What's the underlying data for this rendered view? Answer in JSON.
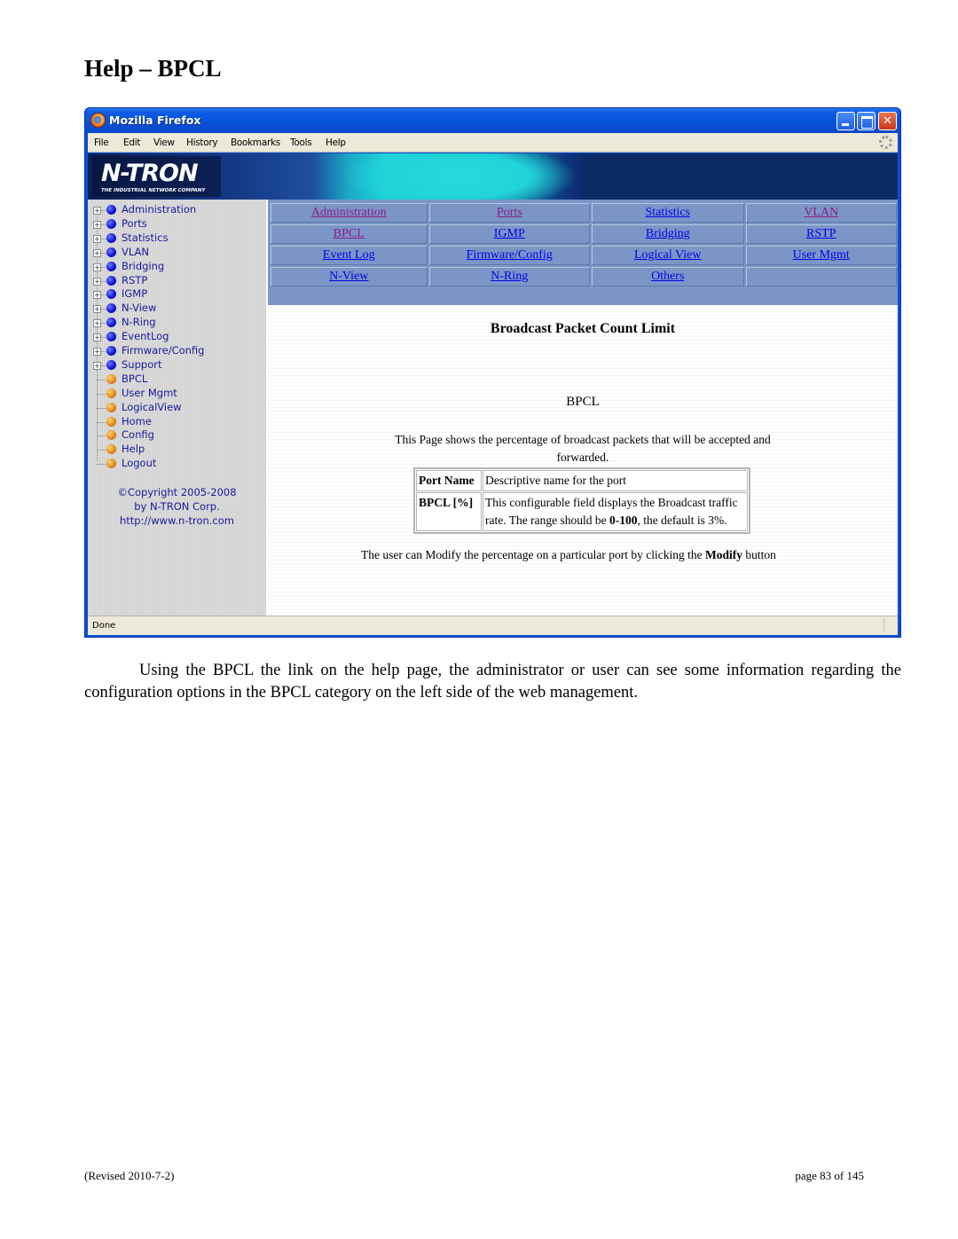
{
  "document": {
    "title": "Help – BPCL",
    "paragraph": "Using the BPCL the link on the help page, the administrator or user can see some information regarding the configuration options in the BPCL category on the left side of the web management.",
    "footer_left": "(Revised 2010-7-2)",
    "footer_right": "page 83 of 145"
  },
  "browser": {
    "app_title": "Mozilla Firefox",
    "menu": [
      "File",
      "Edit",
      "View",
      "History",
      "Bookmarks",
      "Tools",
      "Help"
    ],
    "status": "Done",
    "colors": {
      "titlebar": "#0550d8",
      "chrome": "#ece9d8"
    }
  },
  "banner": {
    "logo": "N-TRON",
    "tagline": "THE INDUSTRIAL NETWORK COMPANY"
  },
  "sidebar": {
    "expandable_items": [
      {
        "label": "Administration",
        "icon": "blue-bullet-icon"
      },
      {
        "label": "Ports",
        "icon": "blue-bullet-icon"
      },
      {
        "label": "Statistics",
        "icon": "blue-bullet-icon"
      },
      {
        "label": "VLAN",
        "icon": "blue-bullet-icon"
      },
      {
        "label": "Bridging",
        "icon": "blue-bullet-icon"
      },
      {
        "label": "RSTP",
        "icon": "blue-bullet-icon"
      },
      {
        "label": "IGMP",
        "icon": "blue-bullet-icon"
      },
      {
        "label": "N-View",
        "icon": "blue-bullet-icon"
      },
      {
        "label": "N-Ring",
        "icon": "blue-bullet-icon"
      },
      {
        "label": "EventLog",
        "icon": "blue-bullet-icon"
      },
      {
        "label": "Firmware/Config",
        "icon": "blue-bullet-icon"
      },
      {
        "label": "Support",
        "icon": "blue-bullet-icon"
      }
    ],
    "leaf_items": [
      {
        "label": "BPCL",
        "icon": "orange-bullet-icon"
      },
      {
        "label": "User Mgmt",
        "icon": "orange-bullet-icon"
      },
      {
        "label": "LogicalView",
        "icon": "orange-bullet-icon"
      },
      {
        "label": "Home",
        "icon": "orange-bullet-icon"
      },
      {
        "label": "Config",
        "icon": "orange-bullet-icon"
      },
      {
        "label": "Help",
        "icon": "orange-bullet-icon"
      },
      {
        "label": "Logout",
        "icon": "orange-bullet-icon"
      }
    ],
    "copyright": [
      "©Copyright 2005-2008",
      "by N-TRON Corp.",
      "http://www.n-tron.com"
    ]
  },
  "nav": {
    "rows": [
      [
        {
          "label": "Administration",
          "visited": true
        },
        {
          "label": "Ports",
          "visited": true
        },
        {
          "label": "Statistics",
          "visited": false
        },
        {
          "label": "VLAN",
          "visited": true
        }
      ],
      [
        {
          "label": "BPCL",
          "visited": true
        },
        {
          "label": "IGMP",
          "visited": false
        },
        {
          "label": "Bridging",
          "visited": false
        },
        {
          "label": "RSTP",
          "visited": false
        }
      ],
      [
        {
          "label": "Event Log",
          "visited": false
        },
        {
          "label": "Firmware/Config",
          "visited": false
        },
        {
          "label": "Logical View",
          "visited": false
        },
        {
          "label": "User Mgmt",
          "visited": false
        }
      ],
      [
        {
          "label": "N-View",
          "visited": false
        },
        {
          "label": "N-Ring",
          "visited": false
        },
        {
          "label": "Others",
          "visited": false
        },
        null
      ]
    ],
    "colors": {
      "cell_bg": "#7b96c6",
      "link": "#0000ee",
      "visited": "#8a1a8a"
    }
  },
  "help_page": {
    "heading": "Broadcast Packet Count Limit",
    "section": "BPCL",
    "intro": "This Page shows the percentage of broadcast packets that will be accepted and forwarded.",
    "table": [
      {
        "key": "Port Name",
        "desc_parts": [
          "Descriptive name for the port"
        ]
      },
      {
        "key": "BPCL [%]",
        "desc_parts": [
          "This configurable field displays the Broadcast traffic rate. The range should be ",
          "0-100",
          ", the default is 3%."
        ]
      }
    ],
    "outro_parts": [
      "The user can Modify the percentage on a particular port by clicking the ",
      "Modify",
      " button"
    ]
  }
}
